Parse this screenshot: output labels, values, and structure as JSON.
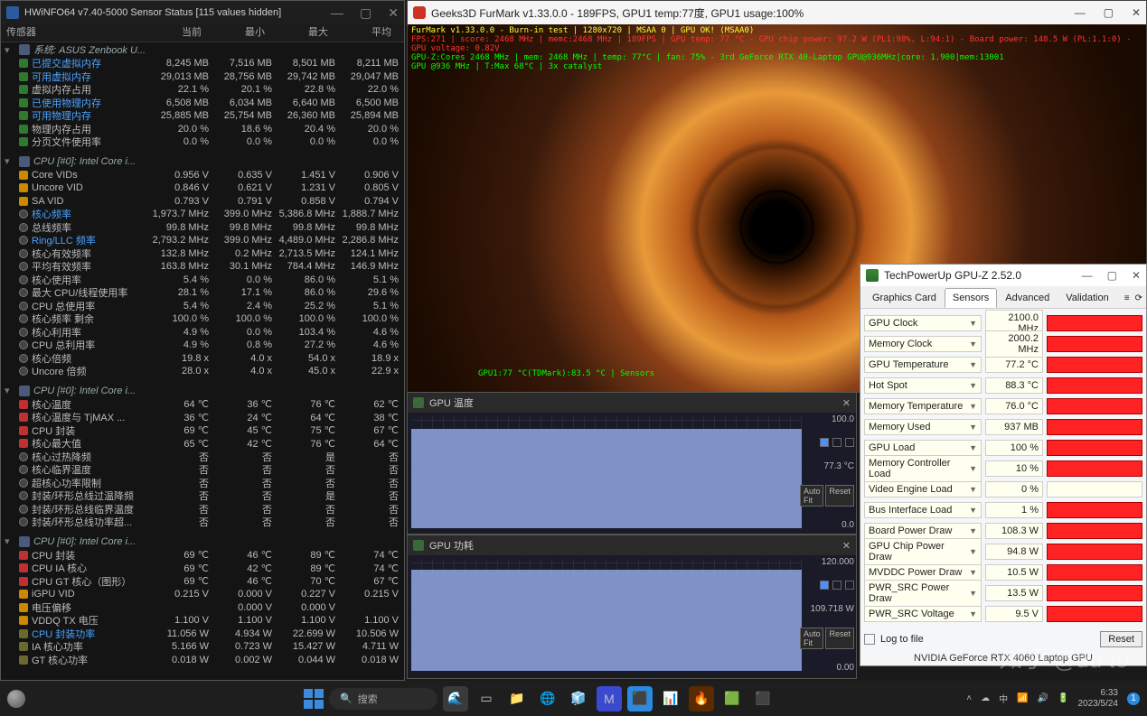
{
  "hwinfo": {
    "title": "HWiNFO64 v7.40-5000 Sensor Status [115 values hidden]",
    "header": [
      "传感器",
      "当前",
      "最小",
      "最大",
      "平均"
    ],
    "groups": [
      {
        "label": "系统: ASUS Zenbook U...",
        "rows": [
          {
            "icon": "mem",
            "hi": true,
            "name": "已提交虚拟内存",
            "v": [
              "8,245 MB",
              "7,516 MB",
              "8,501 MB",
              "8,211 MB"
            ]
          },
          {
            "icon": "mem",
            "hi": true,
            "name": "可用虚拟内存",
            "v": [
              "29,013 MB",
              "28,756 MB",
              "29,742 MB",
              "29,047 MB"
            ]
          },
          {
            "icon": "mem",
            "name": "虚拟内存占用",
            "v": [
              "22.1 %",
              "20.1 %",
              "22.8 %",
              "22.0 %"
            ]
          },
          {
            "icon": "mem",
            "hi": true,
            "name": "已使用物理内存",
            "v": [
              "6,508 MB",
              "6,034 MB",
              "6,640 MB",
              "6,500 MB"
            ]
          },
          {
            "icon": "mem",
            "hi": true,
            "name": "可用物理内存",
            "v": [
              "25,885 MB",
              "25,754 MB",
              "26,360 MB",
              "25,894 MB"
            ]
          },
          {
            "icon": "mem",
            "name": "物理内存占用",
            "v": [
              "20.0 %",
              "18.6 %",
              "20.4 %",
              "20.0 %"
            ]
          },
          {
            "icon": "mem",
            "name": "分页文件使用率",
            "v": [
              "0.0 %",
              "0.0 %",
              "0.0 %",
              "0.0 %"
            ]
          }
        ]
      },
      {
        "label": "CPU [#0]: Intel Core i...",
        "rows": [
          {
            "icon": "volt",
            "name": "Core VIDs",
            "v": [
              "0.956 V",
              "0.635 V",
              "1.451 V",
              "0.906 V"
            ]
          },
          {
            "icon": "volt",
            "name": "Uncore VID",
            "v": [
              "0.846 V",
              "0.621 V",
              "1.231 V",
              "0.805 V"
            ]
          },
          {
            "icon": "volt",
            "name": "SA VID",
            "v": [
              "0.793 V",
              "0.791 V",
              "0.858 V",
              "0.794 V"
            ]
          },
          {
            "icon": "clock",
            "hi": true,
            "name": "核心频率",
            "v": [
              "1,973.7 MHz",
              "399.0 MHz",
              "5,386.8 MHz",
              "1,888.7 MHz"
            ]
          },
          {
            "icon": "clock",
            "name": "总线频率",
            "v": [
              "99.8 MHz",
              "99.8 MHz",
              "99.8 MHz",
              "99.8 MHz"
            ]
          },
          {
            "icon": "clock",
            "hi": true,
            "name": "Ring/LLC 频率",
            "v": [
              "2,793.2 MHz",
              "399.0 MHz",
              "4,489.0 MHz",
              "2,286.8 MHz"
            ]
          },
          {
            "icon": "clock",
            "name": "核心有效频率",
            "v": [
              "132.8 MHz",
              "0.2 MHz",
              "2,713.5 MHz",
              "124.1 MHz"
            ]
          },
          {
            "icon": "clock",
            "name": "平均有效频率",
            "v": [
              "163.8 MHz",
              "30.1 MHz",
              "784.4 MHz",
              "146.9 MHz"
            ]
          },
          {
            "icon": "clock",
            "name": "核心使用率",
            "v": [
              "5.4 %",
              "0.0 %",
              "86.0 %",
              "5.1 %"
            ]
          },
          {
            "icon": "clock",
            "name": "最大 CPU/线程使用率",
            "v": [
              "28.1 %",
              "17.1 %",
              "86.0 %",
              "29.6 %"
            ]
          },
          {
            "icon": "clock",
            "name": "CPU 总使用率",
            "v": [
              "5.4 %",
              "2.4 %",
              "25.2 %",
              "5.1 %"
            ]
          },
          {
            "icon": "clock",
            "name": "核心频率 剩余",
            "v": [
              "100.0 %",
              "100.0 %",
              "100.0 %",
              "100.0 %"
            ]
          },
          {
            "icon": "clock",
            "name": "核心利用率",
            "v": [
              "4.9 %",
              "0.0 %",
              "103.4 %",
              "4.6 %"
            ]
          },
          {
            "icon": "clock",
            "name": "CPU 总利用率",
            "v": [
              "4.9 %",
              "0.8 %",
              "27.2 %",
              "4.6 %"
            ]
          },
          {
            "icon": "clock",
            "name": "核心倍频",
            "v": [
              "19.8 x",
              "4.0 x",
              "54.0 x",
              "18.9 x"
            ]
          },
          {
            "icon": "clock",
            "name": "Uncore 倍频",
            "v": [
              "28.0 x",
              "4.0 x",
              "45.0 x",
              "22.9 x"
            ]
          }
        ]
      },
      {
        "label": "CPU [#0]: Intel Core i...",
        "rows": [
          {
            "icon": "temp",
            "name": "核心温度",
            "v": [
              "64 ℃",
              "36 ℃",
              "76 ℃",
              "62 ℃"
            ]
          },
          {
            "icon": "temp",
            "name": "核心温度与 TjMAX ...",
            "v": [
              "36 ℃",
              "24 ℃",
              "64 ℃",
              "38 ℃"
            ]
          },
          {
            "icon": "temp",
            "name": "CPU 封装",
            "v": [
              "69 ℃",
              "45 ℃",
              "75 ℃",
              "67 ℃"
            ]
          },
          {
            "icon": "temp",
            "name": "核心最大值",
            "v": [
              "65 ℃",
              "42 ℃",
              "76 ℃",
              "64 ℃"
            ]
          },
          {
            "icon": "clock",
            "name": "核心过热降频",
            "v": [
              "否",
              "否",
              "是",
              "否"
            ]
          },
          {
            "icon": "clock",
            "name": "核心临界温度",
            "v": [
              "否",
              "否",
              "否",
              "否"
            ]
          },
          {
            "icon": "clock",
            "name": "超核心功率限制",
            "v": [
              "否",
              "否",
              "否",
              "否"
            ]
          },
          {
            "icon": "clock",
            "name": "封装/环形总线过温降频",
            "v": [
              "否",
              "否",
              "是",
              "否"
            ]
          },
          {
            "icon": "clock",
            "name": "封装/环形总线临界温度",
            "v": [
              "否",
              "否",
              "否",
              "否"
            ]
          },
          {
            "icon": "clock",
            "name": "封装/环形总线功率超...",
            "v": [
              "否",
              "否",
              "否",
              "否"
            ]
          }
        ]
      },
      {
        "label": "CPU [#0]: Intel Core i...",
        "rows": [
          {
            "icon": "temp",
            "name": "CPU 封装",
            "v": [
              "69 ℃",
              "46 ℃",
              "89 ℃",
              "74 ℃"
            ]
          },
          {
            "icon": "temp",
            "name": "CPU IA 核心",
            "v": [
              "69 ℃",
              "42 ℃",
              "89 ℃",
              "74 ℃"
            ]
          },
          {
            "icon": "temp",
            "name": "CPU GT 核心（图形）",
            "v": [
              "69 ℃",
              "46 ℃",
              "70 ℃",
              "67 ℃"
            ]
          },
          {
            "icon": "volt",
            "name": "iGPU VID",
            "v": [
              "0.215 V",
              "0.000 V",
              "0.227 V",
              "0.215 V"
            ]
          },
          {
            "icon": "volt",
            "name": "电压偏移",
            "v": [
              "",
              "0.000 V",
              "0.000 V",
              ""
            ]
          },
          {
            "icon": "volt",
            "name": "VDDQ TX 电压",
            "v": [
              "1.100 V",
              "1.100 V",
              "1.100 V",
              "1.100 V"
            ]
          },
          {
            "icon": "pwr",
            "hi": true,
            "name": "CPU 封装功率",
            "v": [
              "11.056 W",
              "4.934 W",
              "22.699 W",
              "10.506 W"
            ]
          },
          {
            "icon": "pwr",
            "name": "IA 核心功率",
            "v": [
              "5.166 W",
              "0.723 W",
              "15.427 W",
              "4.711 W"
            ]
          },
          {
            "icon": "pwr",
            "name": "GT 核心功率",
            "v": [
              "0.018 W",
              "0.002 W",
              "0.044 W",
              "0.018 W"
            ]
          }
        ]
      }
    ]
  },
  "furmark": {
    "title": "Geeks3D FurMark v1.33.0.0 - 189FPS, GPU1 temp:77度, GPU1 usage:100%",
    "overlay": [
      "FurMark v1.33.0.0 - Burn-in test | 1280x720 | MSAA 0 | GPU OK! (MSAA0)",
      "FPS:271 | score: 2468 MHz | memc:2468 MHz | 189FPS | GPU temp: 77 °C - GPU chip power: 97.2 W (PL1:98%, L:94:1) - Board power: 148.5 W (PL:1.1:0) - GPU voltage: 0.82V",
      "GPU-Z:Cores 2468 MHz | mem: 2468 MHz | temp: 77°C | fan: 75% - 3rd GeForce RTX 40-Laptop GPU@936MHz|core: 1.900|mem:13001",
      "GPU @936 MHz | T:Max 68°C | 3x catalyst"
    ],
    "bottom": "GPU1:77 °C(TDMark):83.5 °C | Sensors"
  },
  "gpuz": {
    "title": "TechPowerUp GPU-Z 2.52.0",
    "tabs": [
      "Graphics Card",
      "Sensors",
      "Advanced",
      "Validation"
    ],
    "activeTab": 1,
    "rows": [
      {
        "label": "GPU Clock",
        "val": "2100.0 MHz",
        "bar": true
      },
      {
        "label": "Memory Clock",
        "val": "2000.2 MHz",
        "bar": true
      },
      {
        "label": "GPU Temperature",
        "val": "77.2 °C",
        "bar": true
      },
      {
        "label": "Hot Spot",
        "val": "88.3 °C",
        "bar": true
      },
      {
        "label": "Memory Temperature",
        "val": "76.0 °C",
        "bar": true
      },
      {
        "label": "Memory Used",
        "val": "937 MB",
        "bar": true
      },
      {
        "label": "GPU Load",
        "val": "100 %",
        "bar": true
      },
      {
        "label": "Memory Controller Load",
        "val": "10 %",
        "bar": true
      },
      {
        "label": "Video Engine Load",
        "val": "0 %",
        "bar": false
      },
      {
        "label": "Bus Interface Load",
        "val": "1 %",
        "bar": true
      },
      {
        "label": "Board Power Draw",
        "val": "108.3 W",
        "bar": true
      },
      {
        "label": "GPU Chip Power Draw",
        "val": "94.8 W",
        "bar": true
      },
      {
        "label": "MVDDC Power Draw",
        "val": "10.5 W",
        "bar": true
      },
      {
        "label": "PWR_SRC Power Draw",
        "val": "13.5 W",
        "bar": true
      },
      {
        "label": "PWR_SRC Voltage",
        "val": "9.5 V",
        "bar": true
      }
    ],
    "log": "Log to file",
    "reset": "Reset",
    "device": "NVIDIA GeForce RTX 4060 Laptop GPU"
  },
  "graph1": {
    "title": "GPU 温度",
    "top": "100.0",
    "val": "77.3 °C",
    "bot": "0.0",
    "autofit": "Auto Fit",
    "reset": "Reset"
  },
  "graph2": {
    "title": "GPU 功耗",
    "top": "120.000",
    "val": "109.718 W",
    "bot": "0.00",
    "autofit": "Auto Fit",
    "reset": "Reset"
  },
  "taskbar": {
    "search": "搜索",
    "time": "6:33",
    "date": "2023/5/24",
    "trayLang": "中"
  },
  "watermark": "知乎 @dd to"
}
